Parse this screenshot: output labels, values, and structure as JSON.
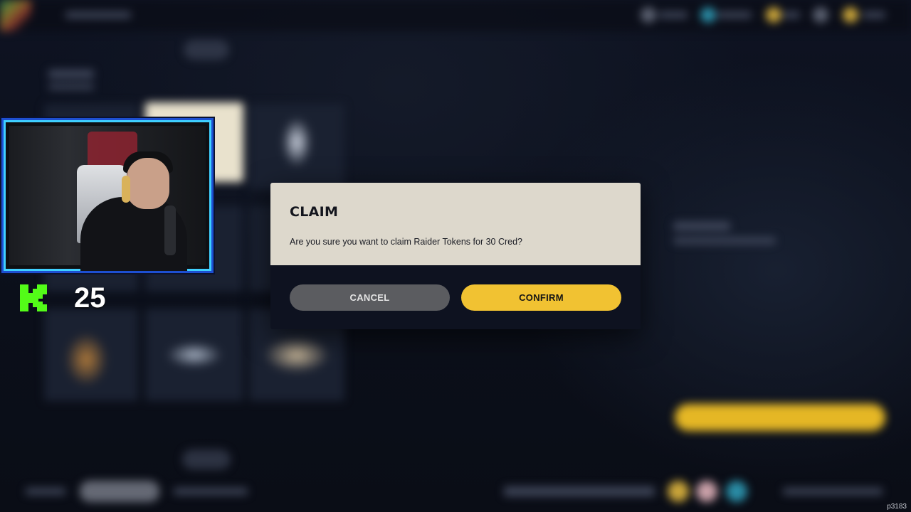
{
  "modal": {
    "title": "CLAIM",
    "message": "Are you sure you want to claim Raider Tokens for 30 Cred?",
    "cancel_label": "CANCEL",
    "confirm_label": "CONFIRM"
  },
  "overlay": {
    "kick_follower_count": "25",
    "corner_id": "p3183"
  },
  "colors": {
    "confirm_button": "#f1c232",
    "cancel_button": "#5b5c60",
    "modal_header": "#ddd8cc",
    "modal_footer": "#0e1220",
    "kick_green": "#53fc18",
    "webcam_border": "#1d4fd1"
  },
  "icons": {
    "kick_logo": "kick-logo-icon"
  }
}
